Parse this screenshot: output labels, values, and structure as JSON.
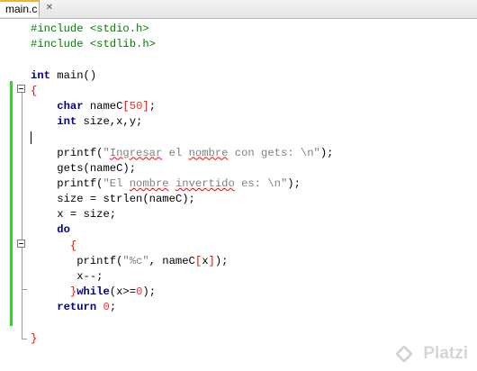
{
  "tab": {
    "label": "main.c",
    "close_glyph": "✕"
  },
  "code_lines": [
    [
      {
        "t": "#include <stdio.h>",
        "c": "pp"
      }
    ],
    [
      {
        "t": "#include <stdlib.h>",
        "c": "pp"
      }
    ],
    [],
    [
      {
        "t": "int",
        "c": "kw"
      },
      {
        "t": " main()",
        "c": ""
      }
    ],
    [
      {
        "t": "{",
        "c": "br"
      }
    ],
    [
      {
        "t": "    ",
        "c": ""
      },
      {
        "t": "char",
        "c": "kw"
      },
      {
        "t": " nameC",
        "c": ""
      },
      {
        "t": "[",
        "c": "br"
      },
      {
        "t": "50",
        "c": "num"
      },
      {
        "t": "]",
        "c": "br"
      },
      {
        "t": ";",
        "c": ""
      }
    ],
    [
      {
        "t": "    ",
        "c": ""
      },
      {
        "t": "int",
        "c": "kw"
      },
      {
        "t": " size,x,y;",
        "c": ""
      }
    ],
    [],
    [
      {
        "t": "    printf(",
        "c": ""
      },
      {
        "t": "\"",
        "c": "str"
      },
      {
        "t": "Ingresar",
        "c": "str sq"
      },
      {
        "t": " el ",
        "c": "str"
      },
      {
        "t": "nombre",
        "c": "str sq"
      },
      {
        "t": " con gets: \\n\"",
        "c": "str"
      },
      {
        "t": ");",
        "c": ""
      }
    ],
    [
      {
        "t": "    gets(nameC);",
        "c": ""
      }
    ],
    [
      {
        "t": "    printf(",
        "c": ""
      },
      {
        "t": "\"El ",
        "c": "str"
      },
      {
        "t": "nombre",
        "c": "str sq"
      },
      {
        "t": " ",
        "c": "str"
      },
      {
        "t": "invertido",
        "c": "str sq"
      },
      {
        "t": " es: \\n\"",
        "c": "str"
      },
      {
        "t": ");",
        "c": ""
      }
    ],
    [
      {
        "t": "    size = strlen(nameC);",
        "c": ""
      }
    ],
    [
      {
        "t": "    x = size;",
        "c": ""
      }
    ],
    [
      {
        "t": "    ",
        "c": ""
      },
      {
        "t": "do",
        "c": "kw"
      }
    ],
    [
      {
        "t": "      ",
        "c": ""
      },
      {
        "t": "{",
        "c": "br"
      }
    ],
    [
      {
        "t": "       printf(",
        "c": ""
      },
      {
        "t": "\"%c\"",
        "c": "str"
      },
      {
        "t": ", nameC",
        "c": ""
      },
      {
        "t": "[",
        "c": "br"
      },
      {
        "t": "x",
        "c": ""
      },
      {
        "t": "]",
        "c": "br"
      },
      {
        "t": ");",
        "c": ""
      }
    ],
    [
      {
        "t": "       x--;",
        "c": ""
      }
    ],
    [
      {
        "t": "      ",
        "c": ""
      },
      {
        "t": "}",
        "c": "br"
      },
      {
        "t": "while",
        "c": "kw"
      },
      {
        "t": "(x>=",
        "c": ""
      },
      {
        "t": "0",
        "c": "num"
      },
      {
        "t": ");",
        "c": ""
      }
    ],
    [
      {
        "t": "    ",
        "c": ""
      },
      {
        "t": "return",
        "c": "kw"
      },
      {
        "t": " ",
        "c": ""
      },
      {
        "t": "0",
        "c": "num"
      },
      {
        "t": ";",
        "c": ""
      }
    ],
    [],
    [
      {
        "t": "}",
        "c": "br"
      }
    ]
  ],
  "watermark": {
    "text": "Platzi",
    "icon": "platzi-logo-icon"
  }
}
